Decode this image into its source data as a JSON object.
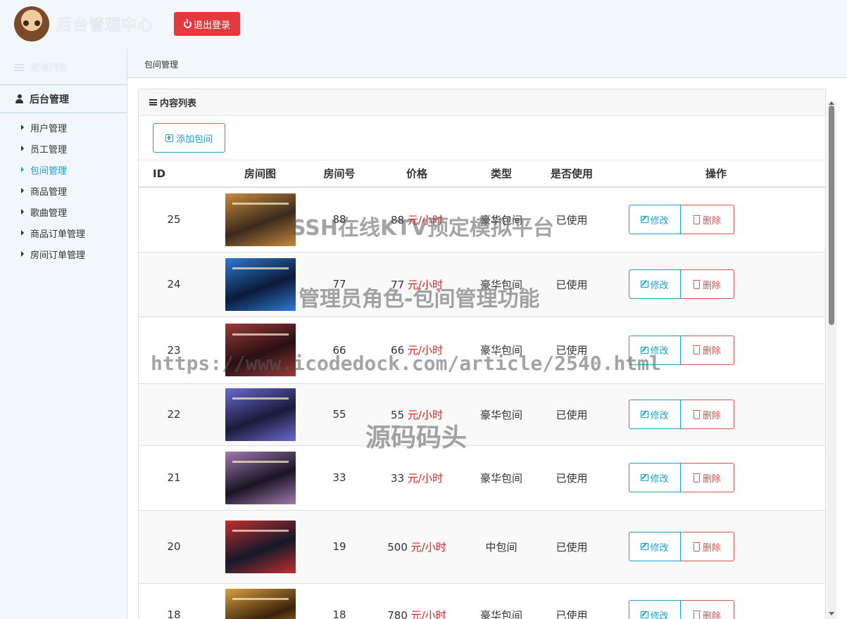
{
  "header": {
    "app_title": "后台管理中心",
    "logout_label": "退出登录",
    "accent_color": "#e43a3d"
  },
  "sidebar": {
    "menu_title": "菜单列表",
    "section_title": "后台管理",
    "items": [
      {
        "label": "用户管理",
        "active": false
      },
      {
        "label": "员工管理",
        "active": false
      },
      {
        "label": "包间管理",
        "active": true
      },
      {
        "label": "商品管理",
        "active": false
      },
      {
        "label": "歌曲管理",
        "active": false
      },
      {
        "label": "商品订单管理",
        "active": false
      },
      {
        "label": "房间订单管理",
        "active": false
      }
    ]
  },
  "breadcrumb": {
    "current": "包间管理"
  },
  "panel": {
    "title": "内容列表",
    "add_label": "添加包间"
  },
  "table": {
    "headers": [
      "ID",
      "房间图",
      "房间号",
      "价格",
      "类型",
      "是否使用",
      "操作"
    ],
    "price_unit": "元/小时",
    "edit_label": "修改",
    "delete_label": "删除",
    "rows": [
      {
        "id": "25",
        "room_no": "88",
        "price": "88",
        "type": "豪华包间",
        "used": "已使用",
        "img_colors": [
          "#3a2a1c",
          "#c98a3e"
        ]
      },
      {
        "id": "24",
        "room_no": "77",
        "price": "77",
        "type": "豪华包间",
        "used": "已使用",
        "img_colors": [
          "#0b1a3a",
          "#2f7ad1"
        ]
      },
      {
        "id": "23",
        "room_no": "66",
        "price": "66",
        "type": "豪华包间",
        "used": "已使用",
        "img_colors": [
          "#2a0f12",
          "#9a3a3a"
        ]
      },
      {
        "id": "22",
        "room_no": "55",
        "price": "55",
        "type": "豪华包间",
        "used": "已使用",
        "img_colors": [
          "#1a1a3a",
          "#6a6ad0"
        ]
      },
      {
        "id": "21",
        "room_no": "33",
        "price": "33",
        "type": "豪华包间",
        "used": "已使用",
        "img_colors": [
          "#1a1424",
          "#a07ab0"
        ]
      },
      {
        "id": "20",
        "room_no": "19",
        "price": "500",
        "type": "中包间",
        "used": "已使用",
        "img_colors": [
          "#14182a",
          "#c03030"
        ]
      },
      {
        "id": "18",
        "room_no": "18",
        "price": "780",
        "type": "豪华包间",
        "used": "已使用",
        "img_colors": [
          "#3a220a",
          "#d9a040"
        ]
      }
    ]
  },
  "watermark": {
    "line1": "SSH在线KTV预定模拟平台",
    "line2": "管理员角色-包间管理功能",
    "line3": "https://www.icodedock.com/article/2540.html",
    "line4": "源码码头"
  }
}
